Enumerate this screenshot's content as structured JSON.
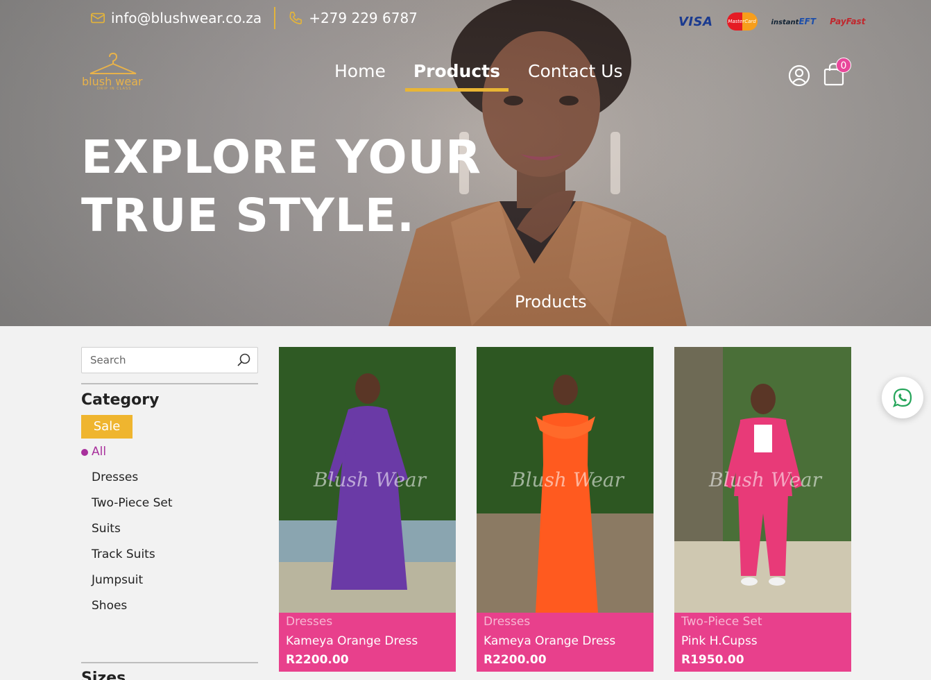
{
  "topbar": {
    "email": "info@blushwear.co.za",
    "phone": "+279 229 6787"
  },
  "payments": {
    "visa": "VISA",
    "mastercard": "MasterCard",
    "instant_eft_a": "instant",
    "instant_eft_b": "EFT",
    "payfast": "PayFast"
  },
  "logo": {
    "text": "blush wear",
    "tagline": "DRIP IN CLASS"
  },
  "nav": {
    "home": "Home",
    "products": "Products",
    "contact": "Contact Us"
  },
  "cart": {
    "count": "0"
  },
  "hero": {
    "line1": "EXPLORE YOUR",
    "line2": "TRUE STYLE.",
    "subtitle": "Products"
  },
  "sidebar": {
    "search_placeholder": "Search",
    "category_title": "Category",
    "sale_label": "Sale",
    "categories": [
      "All",
      "Dresses",
      "Two-Piece Set",
      "Suits",
      "Track Suits",
      "Jumpsuit",
      "Shoes"
    ],
    "sizes_title": "Sizes"
  },
  "products": [
    {
      "category": "Dresses",
      "name": "Kameya Orange Dress",
      "price": "R2200.00",
      "dress_color": "#6a3aa6"
    },
    {
      "category": "Dresses",
      "name": "Kameya Orange Dress",
      "price": "R2200.00",
      "dress_color": "#ff5a1f"
    },
    {
      "category": "Two-Piece Set",
      "name": "Pink H.Cupss",
      "price": "R1950.00",
      "dress_color": "#e83a78"
    }
  ],
  "watermark": "Blush Wear",
  "colors": {
    "accent_gold": "#efb52f",
    "card_pink": "#e8408c",
    "active_purple": "#a8309c"
  },
  "icons": [
    "mail-icon",
    "phone-icon",
    "user-icon",
    "cart-icon",
    "search-icon",
    "whatsapp-icon"
  ]
}
